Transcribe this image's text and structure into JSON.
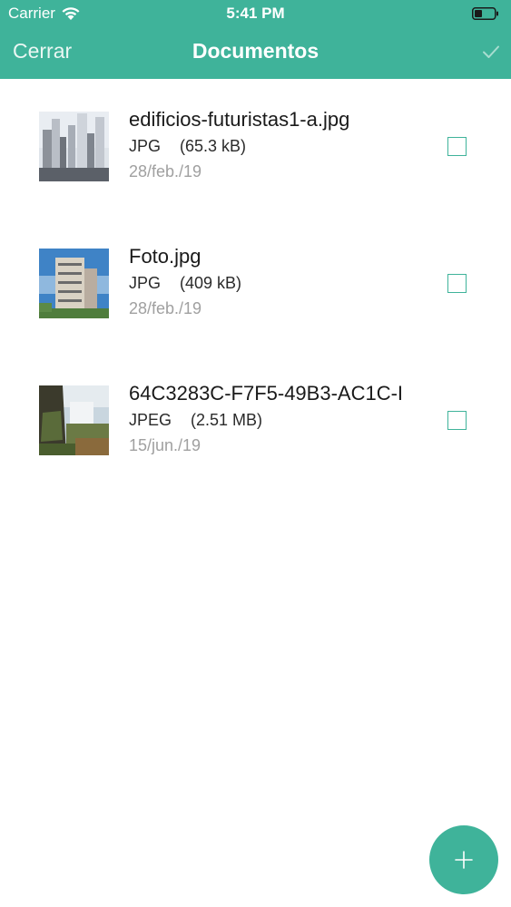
{
  "status_bar": {
    "carrier": "Carrier",
    "time": "5:41 PM"
  },
  "nav": {
    "close_label": "Cerrar",
    "title": "Documentos",
    "confirm_icon": "checkmark-icon"
  },
  "documents": [
    {
      "name": "edificios-futuristas1-a.jpg",
      "type": "JPG",
      "size": "(65.3 kB)",
      "date": "28/feb./19",
      "selected": false,
      "thumbnail_icon": "skyscrapers-thumbnail"
    },
    {
      "name": "Foto.jpg",
      "type": "JPG",
      "size": "(409 kB)",
      "date": "28/feb./19",
      "selected": false,
      "thumbnail_icon": "building-thumbnail"
    },
    {
      "name": "64C3283C-F7F5-49B3-AC1C-I",
      "type": "JPEG",
      "size": "(2.51 MB)",
      "date": "15/jun./19",
      "selected": false,
      "thumbnail_icon": "waterfall-thumbnail"
    }
  ],
  "fab": {
    "icon": "plus-icon"
  },
  "colors": {
    "accent": "#3fb39a",
    "date_text": "#a0a0a0"
  }
}
